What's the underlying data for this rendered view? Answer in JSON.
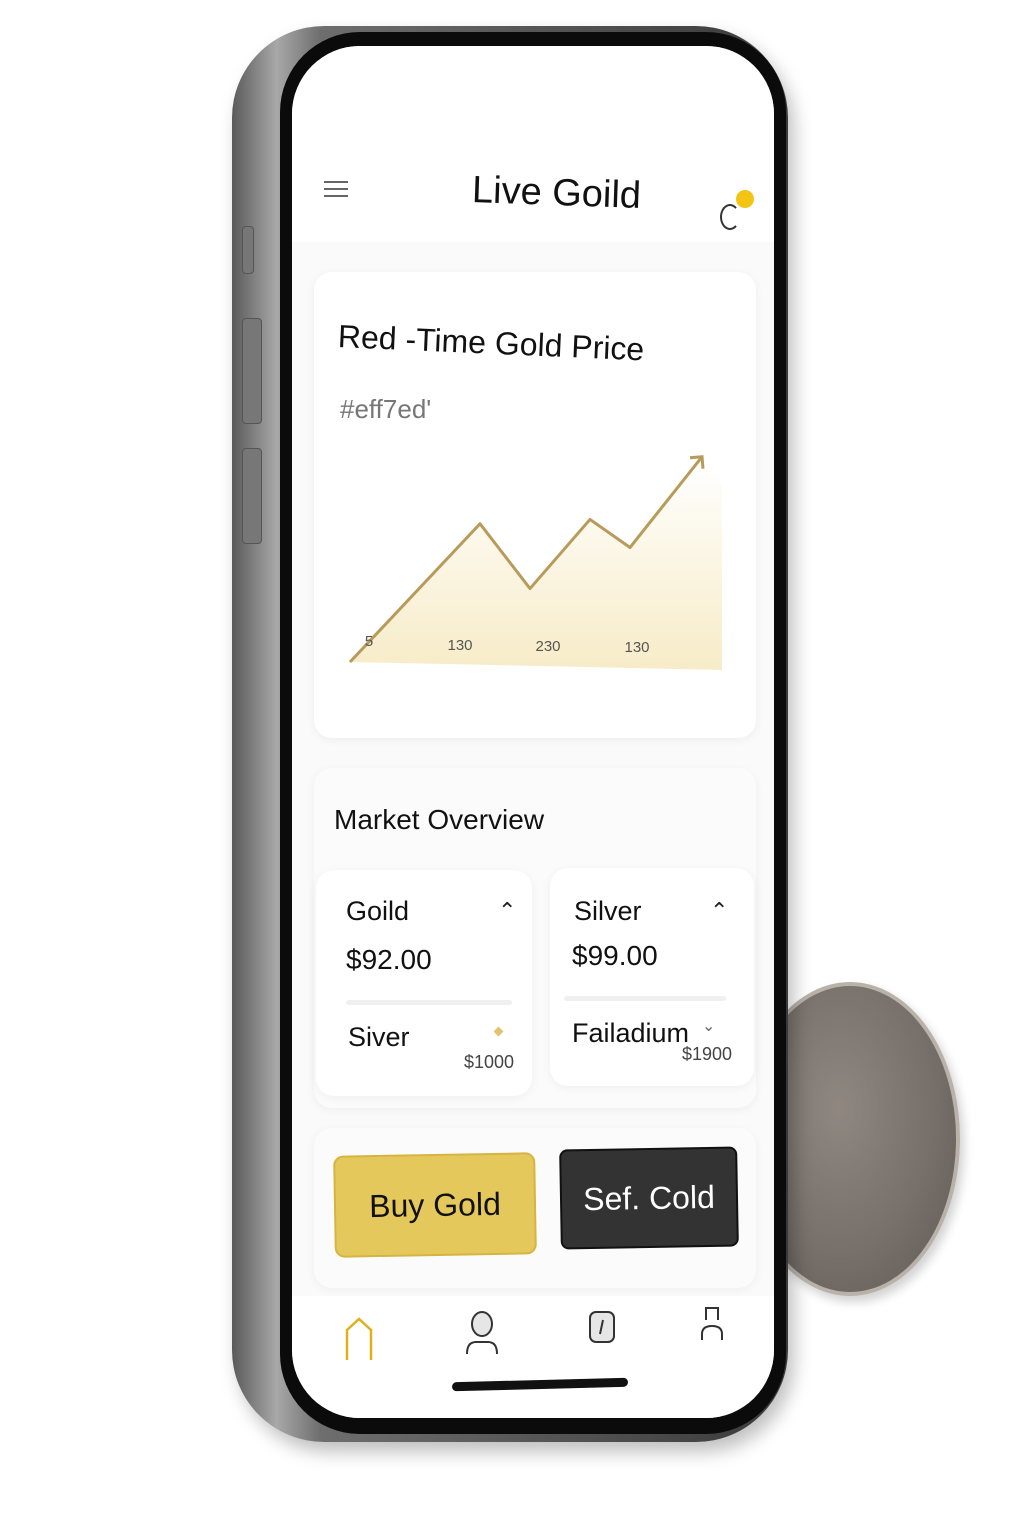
{
  "header": {
    "title": "Live Goild",
    "menu_icon": "hamburger-menu-icon",
    "notification_icon": "bell-icon",
    "notification_dot_color": "#f4c414"
  },
  "price_card": {
    "title": "Red -Time Gold Price",
    "subtitle": "#eff7ed'"
  },
  "chart_data": {
    "type": "area",
    "x_tick_labels": [
      "5",
      "130",
      "230",
      "130"
    ],
    "values": [
      0,
      64,
      34,
      66,
      53,
      95
    ],
    "line_color": "#b89a5a",
    "fill_color": "#f7ecc8",
    "grid": false,
    "trend_arrow": true
  },
  "market": {
    "title": "Market Overview",
    "cards": [
      {
        "name": "Goild",
        "price": "$92.00",
        "trend": "up",
        "sub_name": "Siver",
        "sub_price": "$1000",
        "sub_icon": "diamond-icon"
      },
      {
        "name": "Silver",
        "price": "$99.00",
        "trend": "up",
        "sub_name": "Failadium",
        "sub_price": "$1900",
        "sub_icon": "chevron-down-icon"
      }
    ]
  },
  "actions": {
    "buy_label": "Buy Gold",
    "sell_label": "Sef. Cold",
    "buy_color": "#e5c85c",
    "sell_color": "#333333"
  },
  "nav": {
    "items": [
      "home-icon",
      "user-icon",
      "card-icon",
      "profile-icon"
    ],
    "active": "home-icon",
    "active_color": "#e0b01c"
  }
}
